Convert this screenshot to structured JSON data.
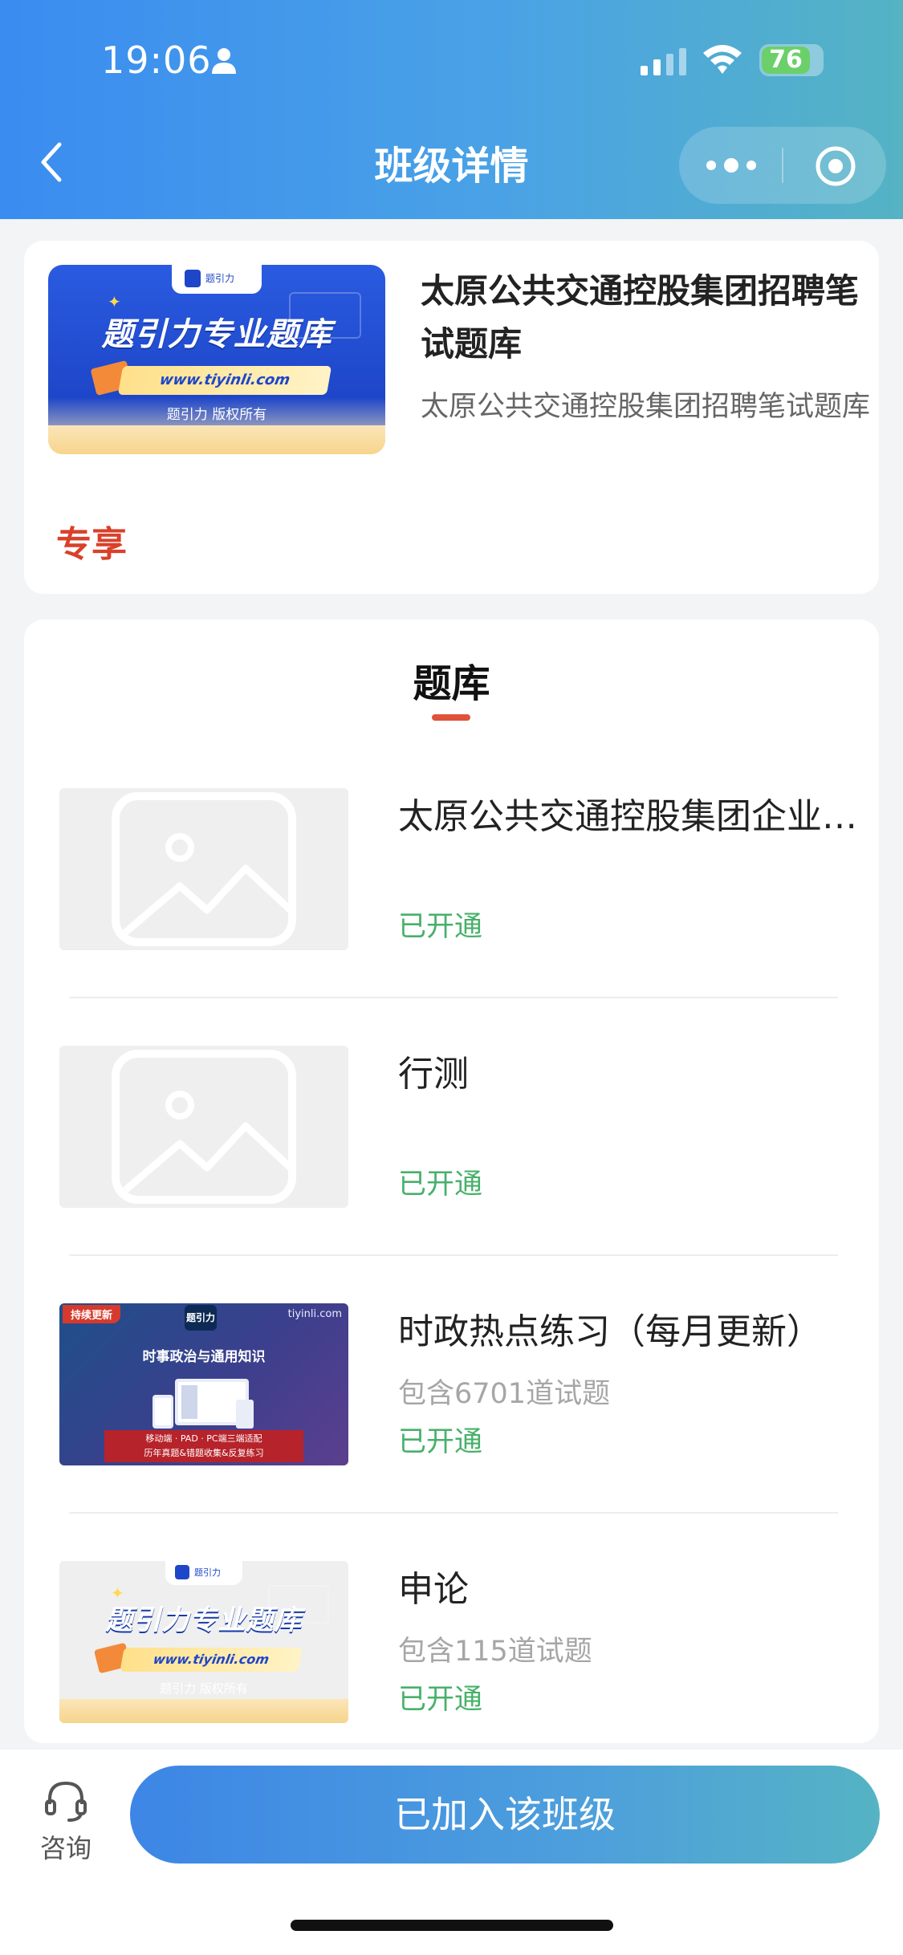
{
  "status_bar": {
    "time": "19:06",
    "battery": "76"
  },
  "nav": {
    "title": "班级详情"
  },
  "course": {
    "title": "太原公共交通控股集团招聘笔试题库",
    "subtitle": "太原公共交通控股集团招聘笔试题库",
    "badge": "专享",
    "cover": {
      "brand": "题引力",
      "headline": "题引力专业题库",
      "url": "www.tiyinli.com",
      "copyright": "题引力 版权所有"
    }
  },
  "bank": {
    "title": "题库",
    "items": [
      {
        "name": "太原公共交通控股集团企业…",
        "count": "",
        "status": "已开通",
        "thumb": "placeholder"
      },
      {
        "name": "行测",
        "count": "",
        "status": "已开通",
        "thumb": "placeholder"
      },
      {
        "name": "时政热点练习（每月更新）",
        "count": "包含6701道试题",
        "status": "已开通",
        "thumb": "promo"
      },
      {
        "name": "申论",
        "count": "包含115道试题",
        "status": "已开通",
        "thumb": "cover"
      }
    ],
    "promo": {
      "tag": "持续更新",
      "logo": "题引力",
      "site": "tiyinli.com",
      "headline": "时事政治与通用知识",
      "banner_line1": "移动端 · PAD · PC端三端适配",
      "banner_line2": "历年真题&错题收集&反复练习"
    }
  },
  "bottom": {
    "consult_label": "咨询",
    "join_label": "已加入该班级"
  },
  "colors": {
    "header_start": "#3a8cf0",
    "header_end": "#55b3c4",
    "status_green": "#48b06a",
    "badge_red": "#d9402a"
  }
}
